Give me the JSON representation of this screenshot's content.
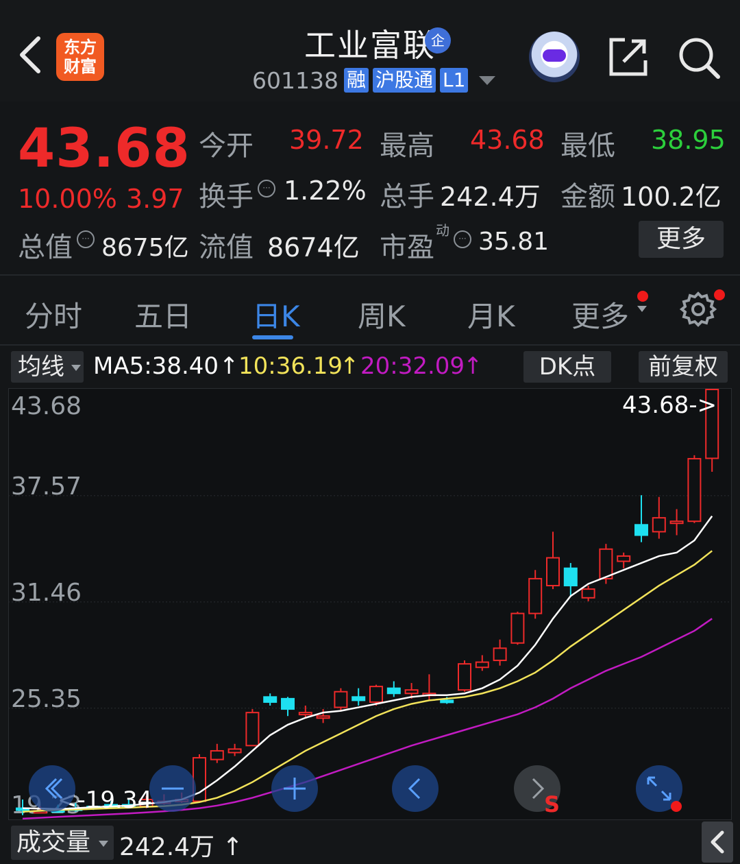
{
  "header": {
    "logo_line1": "东方",
    "logo_line2": "财富",
    "title": "工业富联",
    "title_badge": "企",
    "code": "601138",
    "tags": [
      "融",
      "沪股通",
      "L1"
    ]
  },
  "quote": {
    "price": "43.68",
    "change_pct": "10.00%",
    "change_abs": "3.97",
    "open_label": "今开",
    "open_value": "39.72",
    "high_label": "最高",
    "high_value": "43.68",
    "low_label": "最低",
    "low_value": "38.95",
    "turnover_label": "换手",
    "turnover_value": "1.22%",
    "volume_label": "总手",
    "volume_value": "242.4万",
    "amount_label": "金额",
    "amount_value": "100.2亿",
    "mktcap_label": "总值",
    "mktcap_value": "8675亿",
    "float_label": "流值",
    "float_value": "8674亿",
    "pe_label": "市盈",
    "pe_sup": "动",
    "pe_value": "35.81",
    "more_button": "更多"
  },
  "tabs": [
    {
      "label": "分时"
    },
    {
      "label": "五日"
    },
    {
      "label": "日K",
      "active": true
    },
    {
      "label": "周K"
    },
    {
      "label": "月K"
    },
    {
      "label": "更多"
    }
  ],
  "toolbar": {
    "ma_select": "均线",
    "ma5": "MA5:38.40",
    "ma10": "10:36.19",
    "ma20": "20:32.09",
    "dk_button": "DK点",
    "fq_button": "前复权"
  },
  "colors": {
    "up": "#ee2a2a",
    "down": "#1ee0f0",
    "ma5": "#ffffff",
    "ma10": "#f2e35a",
    "ma20": "#c21bc2",
    "accent": "#3c86e6"
  },
  "chart_data": {
    "type": "candlestick",
    "y_ticks": [
      "43.68",
      "37.57",
      "31.46",
      "25.35",
      "19.23"
    ],
    "ylim": [
      19.23,
      43.68
    ],
    "max_marker": "43.68->",
    "min_marker": "<-19.34",
    "candles": [
      {
        "o": 19.6,
        "c": 19.5,
        "h": 20.1,
        "l": 19.2
      },
      {
        "o": 19.4,
        "c": 19.45,
        "h": 19.7,
        "l": 19.3
      },
      {
        "o": 19.5,
        "c": 19.4,
        "h": 19.8,
        "l": 19.34
      },
      {
        "o": 19.6,
        "c": 19.5,
        "h": 19.9,
        "l": 19.4
      },
      {
        "o": 19.7,
        "c": 19.6,
        "h": 20.0,
        "l": 19.5
      },
      {
        "o": 19.8,
        "c": 19.7,
        "h": 20.0,
        "l": 19.6
      },
      {
        "o": 19.8,
        "c": 19.75,
        "h": 20.1,
        "l": 19.6
      },
      {
        "o": 19.7,
        "c": 20.1,
        "h": 20.3,
        "l": 19.6
      },
      {
        "o": 19.9,
        "c": 20.0,
        "h": 20.4,
        "l": 19.8
      },
      {
        "o": 20.0,
        "c": 20.1,
        "h": 20.5,
        "l": 19.9
      },
      {
        "o": 20.0,
        "c": 22.5,
        "h": 22.7,
        "l": 20.0
      },
      {
        "o": 22.4,
        "c": 22.9,
        "h": 23.3,
        "l": 22.2
      },
      {
        "o": 22.8,
        "c": 23.0,
        "h": 23.3,
        "l": 22.6
      },
      {
        "o": 23.2,
        "c": 25.1,
        "h": 25.3,
        "l": 23.2
      },
      {
        "o": 26.0,
        "c": 25.7,
        "h": 26.2,
        "l": 25.5
      },
      {
        "o": 25.9,
        "c": 25.3,
        "h": 26.0,
        "l": 24.9
      },
      {
        "o": 25.1,
        "c": 25.1,
        "h": 25.5,
        "l": 24.8
      },
      {
        "o": 24.9,
        "c": 24.9,
        "h": 25.3,
        "l": 24.5
      },
      {
        "o": 25.4,
        "c": 26.3,
        "h": 26.5,
        "l": 25.2
      },
      {
        "o": 26.0,
        "c": 25.8,
        "h": 26.5,
        "l": 25.5
      },
      {
        "o": 25.7,
        "c": 26.6,
        "h": 26.7,
        "l": 25.5
      },
      {
        "o": 26.5,
        "c": 26.2,
        "h": 26.9,
        "l": 26.0
      },
      {
        "o": 26.2,
        "c": 26.4,
        "h": 26.8,
        "l": 25.9
      },
      {
        "o": 26.2,
        "c": 26.2,
        "h": 27.3,
        "l": 25.8
      },
      {
        "o": 25.8,
        "c": 25.7,
        "h": 26.0,
        "l": 25.6
      },
      {
        "o": 26.4,
        "c": 27.9,
        "h": 28.1,
        "l": 26.3
      },
      {
        "o": 27.7,
        "c": 28.0,
        "h": 28.4,
        "l": 27.5
      },
      {
        "o": 28.1,
        "c": 28.8,
        "h": 29.3,
        "l": 27.8
      },
      {
        "o": 29.1,
        "c": 30.8,
        "h": 30.9,
        "l": 29.0
      },
      {
        "o": 30.8,
        "c": 32.8,
        "h": 33.3,
        "l": 30.5
      },
      {
        "o": 32.4,
        "c": 34.0,
        "h": 35.5,
        "l": 32.2
      },
      {
        "o": 33.4,
        "c": 32.4,
        "h": 33.7,
        "l": 31.8
      },
      {
        "o": 31.7,
        "c": 32.2,
        "h": 32.4,
        "l": 31.5
      },
      {
        "o": 32.8,
        "c": 34.5,
        "h": 34.8,
        "l": 32.5
      },
      {
        "o": 33.8,
        "c": 34.1,
        "h": 34.3,
        "l": 33.4
      },
      {
        "o": 35.9,
        "c": 35.3,
        "h": 37.6,
        "l": 34.9
      },
      {
        "o": 35.5,
        "c": 36.3,
        "h": 37.5,
        "l": 35.1
      },
      {
        "o": 36.1,
        "c": 36.1,
        "h": 36.8,
        "l": 35.3
      },
      {
        "o": 36.1,
        "c": 39.7,
        "h": 39.9,
        "l": 36.0
      },
      {
        "o": 39.72,
        "c": 43.68,
        "h": 43.68,
        "l": 38.95
      }
    ],
    "ma5": [
      19.6,
      19.58,
      19.55,
      19.6,
      19.66,
      19.7,
      19.75,
      19.85,
      19.95,
      20.1,
      20.5,
      21.2,
      22.0,
      22.9,
      23.8,
      24.4,
      24.8,
      25.1,
      25.2,
      25.4,
      25.6,
      25.8,
      26.0,
      26.1,
      26.1,
      26.2,
      26.5,
      27.0,
      27.8,
      29.0,
      30.5,
      31.8,
      32.5,
      32.9,
      33.3,
      33.7,
      34.1,
      34.3,
      35.0,
      36.4
    ],
    "ma10": [
      19.4,
      19.45,
      19.5,
      19.52,
      19.56,
      19.6,
      19.63,
      19.68,
      19.72,
      19.8,
      19.95,
      20.2,
      20.6,
      21.1,
      21.7,
      22.3,
      22.9,
      23.4,
      23.9,
      24.4,
      24.9,
      25.3,
      25.6,
      25.8,
      25.9,
      26.0,
      26.2,
      26.5,
      26.9,
      27.4,
      28.1,
      28.9,
      29.6,
      30.3,
      31.0,
      31.7,
      32.4,
      33.0,
      33.6,
      34.4
    ],
    "ma20": [
      19.0,
      19.05,
      19.1,
      19.15,
      19.2,
      19.25,
      19.3,
      19.36,
      19.42,
      19.5,
      19.6,
      19.75,
      19.95,
      20.2,
      20.5,
      20.8,
      21.1,
      21.45,
      21.8,
      22.15,
      22.5,
      22.85,
      23.2,
      23.5,
      23.8,
      24.1,
      24.4,
      24.7,
      25.0,
      25.4,
      25.9,
      26.5,
      27.0,
      27.5,
      27.9,
      28.3,
      28.8,
      29.3,
      29.8,
      30.5
    ]
  },
  "bottom": {
    "volume_select": "成交量",
    "volume_value": "242.4万"
  },
  "chart_controls": [
    "rewind-button",
    "zoom-out-button",
    "zoom-in-button",
    "prev-button",
    "next-button",
    "fullscreen-button"
  ],
  "chart_controls_s_label": "S"
}
